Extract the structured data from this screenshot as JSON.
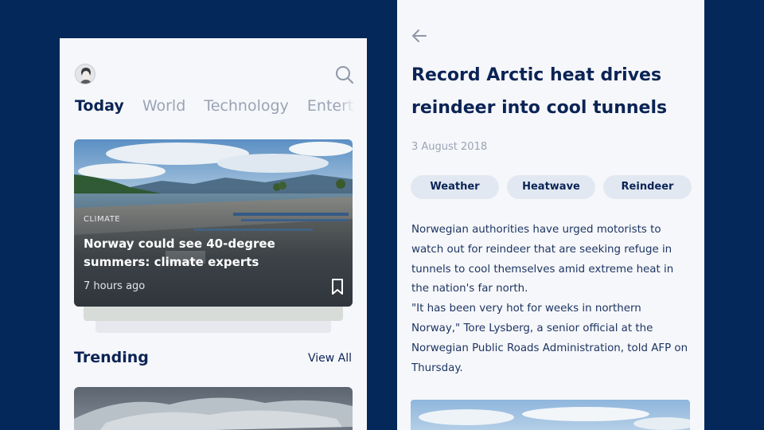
{
  "feed": {
    "tabs": [
      "Today",
      "World",
      "Technology",
      "Entert"
    ],
    "featured": {
      "category": "CLIMATE",
      "title": "Norway could see 40-degree summers: climate experts",
      "time": "7 hours ago"
    },
    "trending": {
      "title": "Trending",
      "view_all": "View All"
    }
  },
  "article": {
    "title": "Record Arctic heat drives reindeer into cool tunnels",
    "date": "3 August 2018",
    "tags": [
      "Weather",
      "Heatwave",
      "Reindeer"
    ],
    "body": [
      "Norwegian authorities have urged motorists to watch out for reindeer that are seeking refuge in tunnels to cool themselves amid extreme heat in the nation's far north.",
      "\"It has been very hot for weeks in northern Norway,\" Tore Lysberg, a senior official at the Norwegian Public Roads Administration, told AFP on Thursday."
    ]
  },
  "colors": {
    "background": "#05285a",
    "accent_text": "#0b2455",
    "muted_text": "#9aa3b5",
    "tag_background": "#e2e8f1"
  },
  "icons": [
    "avatar",
    "search-icon",
    "bookmark-icon",
    "arrow-left-icon"
  ]
}
